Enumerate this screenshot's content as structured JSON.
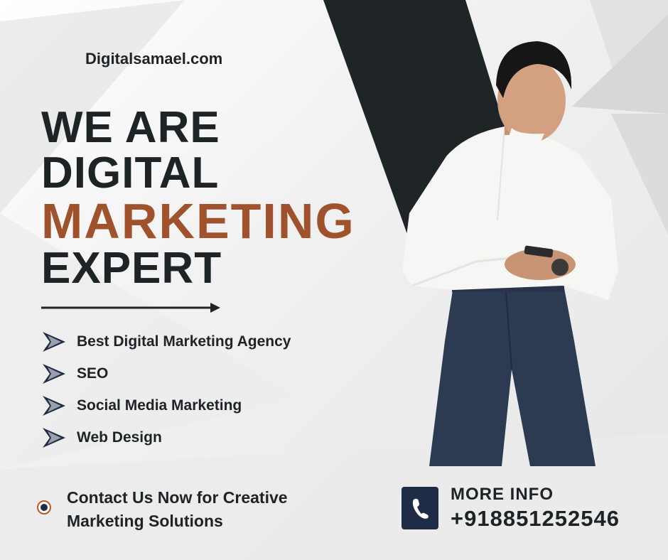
{
  "site": {
    "url": "Digitalsamael.com"
  },
  "headline": {
    "line1": "WE ARE",
    "line2": "DIGITAL",
    "line3": "MARKETING",
    "line4": "EXPERT"
  },
  "services": {
    "items": [
      {
        "label": "Best Digital Marketing Agency"
      },
      {
        "label": "SEO"
      },
      {
        "label": "Social Media Marketing"
      },
      {
        "label": "Web Design"
      }
    ]
  },
  "cta": {
    "line1": "Contact Us Now for Creative",
    "line2": "Marketing Solutions"
  },
  "contact": {
    "more_info": "MORE INFO",
    "phone": "+918851252546",
    "icon": "phone-icon"
  },
  "colors": {
    "dark": "#1e2326",
    "accent": "#a0522d",
    "navy": "#1e2d45",
    "background": "#f1f1f1"
  }
}
